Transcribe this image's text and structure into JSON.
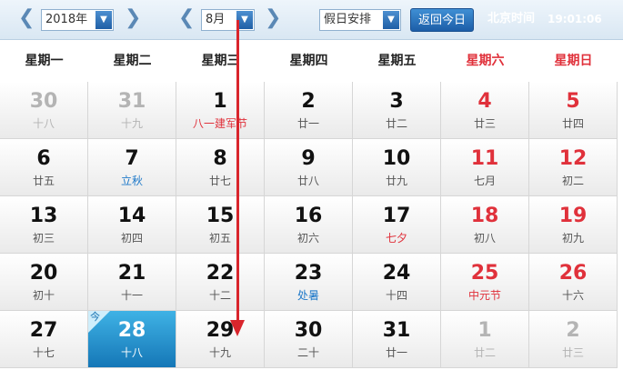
{
  "toolbar": {
    "year_prev": "❮",
    "year_value": "2018年",
    "year_next": "❯",
    "month_prev": "❮",
    "month_value": "8月",
    "month_next": "❯",
    "holiday_value": "假日安排",
    "today_button": "返回今日",
    "clock_label": "北京时间",
    "clock_time": "19:01:06",
    "dropdown_glyph": "▼"
  },
  "weekdays": [
    "星期一",
    "星期二",
    "星期三",
    "星期四",
    "星期五",
    "星期六",
    "星期日"
  ],
  "today_badge": "今",
  "colors": {
    "weekend": "#e0313b",
    "festival": "#e0313b",
    "solar_term": "#1f79c9",
    "today_bg": "#1a8ccf",
    "annotation": "#d9252c"
  },
  "weeks": [
    [
      {
        "day": "30",
        "lunar": "十八",
        "other": true
      },
      {
        "day": "31",
        "lunar": "十九",
        "other": true
      },
      {
        "day": "1",
        "lunar": "八一建军节",
        "festival": true
      },
      {
        "day": "2",
        "lunar": "廿一"
      },
      {
        "day": "3",
        "lunar": "廿二"
      },
      {
        "day": "4",
        "lunar": "廿三"
      },
      {
        "day": "5",
        "lunar": "廿四"
      }
    ],
    [
      {
        "day": "6",
        "lunar": "廿五"
      },
      {
        "day": "7",
        "lunar": "立秋",
        "term": true
      },
      {
        "day": "8",
        "lunar": "廿七"
      },
      {
        "day": "9",
        "lunar": "廿八"
      },
      {
        "day": "10",
        "lunar": "廿九"
      },
      {
        "day": "11",
        "lunar": "七月"
      },
      {
        "day": "12",
        "lunar": "初二"
      }
    ],
    [
      {
        "day": "13",
        "lunar": "初三"
      },
      {
        "day": "14",
        "lunar": "初四"
      },
      {
        "day": "15",
        "lunar": "初五"
      },
      {
        "day": "16",
        "lunar": "初六"
      },
      {
        "day": "17",
        "lunar": "七夕",
        "festival": true
      },
      {
        "day": "18",
        "lunar": "初八"
      },
      {
        "day": "19",
        "lunar": "初九"
      }
    ],
    [
      {
        "day": "20",
        "lunar": "初十"
      },
      {
        "day": "21",
        "lunar": "十一"
      },
      {
        "day": "22",
        "lunar": "十二"
      },
      {
        "day": "23",
        "lunar": "处暑",
        "term": true
      },
      {
        "day": "24",
        "lunar": "十四"
      },
      {
        "day": "25",
        "lunar": "中元节",
        "festival": true
      },
      {
        "day": "26",
        "lunar": "十六"
      }
    ],
    [
      {
        "day": "27",
        "lunar": "十七"
      },
      {
        "day": "28",
        "lunar": "十八",
        "today": true
      },
      {
        "day": "29",
        "lunar": "十九"
      },
      {
        "day": "30",
        "lunar": "二十"
      },
      {
        "day": "31",
        "lunar": "廿一"
      },
      {
        "day": "1",
        "lunar": "廿二",
        "other": true
      },
      {
        "day": "2",
        "lunar": "廿三",
        "other": true
      }
    ]
  ]
}
